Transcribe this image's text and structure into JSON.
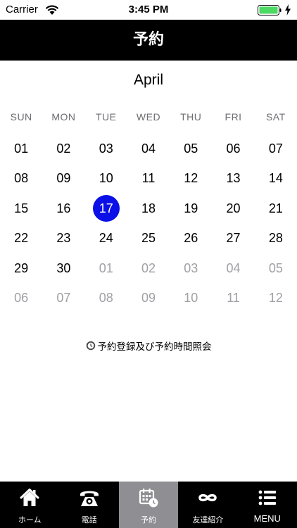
{
  "status_bar": {
    "carrier": "Carrier",
    "time": "3:45 PM",
    "battery_color": "#4cd964"
  },
  "header": {
    "title": "予約"
  },
  "calendar": {
    "month": "April",
    "weekdays": [
      "SUN",
      "MON",
      "TUE",
      "WED",
      "THU",
      "FRI",
      "SAT"
    ],
    "weeks": [
      [
        {
          "d": "01",
          "o": false
        },
        {
          "d": "02",
          "o": false
        },
        {
          "d": "03",
          "o": false
        },
        {
          "d": "04",
          "o": false
        },
        {
          "d": "05",
          "o": false
        },
        {
          "d": "06",
          "o": false
        },
        {
          "d": "07",
          "o": false
        }
      ],
      [
        {
          "d": "08",
          "o": false
        },
        {
          "d": "09",
          "o": false
        },
        {
          "d": "10",
          "o": false
        },
        {
          "d": "11",
          "o": false
        },
        {
          "d": "12",
          "o": false
        },
        {
          "d": "13",
          "o": false
        },
        {
          "d": "14",
          "o": false
        }
      ],
      [
        {
          "d": "15",
          "o": false
        },
        {
          "d": "16",
          "o": false
        },
        {
          "d": "17",
          "o": false
        },
        {
          "d": "18",
          "o": false
        },
        {
          "d": "19",
          "o": false
        },
        {
          "d": "20",
          "o": false
        },
        {
          "d": "21",
          "o": false
        }
      ],
      [
        {
          "d": "22",
          "o": false
        },
        {
          "d": "23",
          "o": false
        },
        {
          "d": "24",
          "o": false
        },
        {
          "d": "25",
          "o": false
        },
        {
          "d": "26",
          "o": false
        },
        {
          "d": "27",
          "o": false
        },
        {
          "d": "28",
          "o": false
        }
      ],
      [
        {
          "d": "29",
          "o": false
        },
        {
          "d": "30",
          "o": false
        },
        {
          "d": "01",
          "o": true
        },
        {
          "d": "02",
          "o": true
        },
        {
          "d": "03",
          "o": true
        },
        {
          "d": "04",
          "o": true
        },
        {
          "d": "05",
          "o": true
        }
      ],
      [
        {
          "d": "06",
          "o": true
        },
        {
          "d": "07",
          "o": true
        },
        {
          "d": "08",
          "o": true
        },
        {
          "d": "09",
          "o": true
        },
        {
          "d": "10",
          "o": true
        },
        {
          "d": "11",
          "o": true
        },
        {
          "d": "12",
          "o": true
        }
      ]
    ],
    "selected_day": "17",
    "selected_color": "#0a10e6"
  },
  "inquiry": {
    "label": "予約登録及び予約時間照会",
    "icon": "clock-history-icon"
  },
  "tabs": [
    {
      "label": "ホーム",
      "icon": "home-icon",
      "active": false
    },
    {
      "label": "電話",
      "icon": "phone-icon",
      "active": false
    },
    {
      "label": "予約",
      "icon": "calendar-clock-icon",
      "active": true
    },
    {
      "label": "友達紹介",
      "icon": "infinity-icon",
      "active": false
    },
    {
      "label": "MENU",
      "icon": "menu-list-icon",
      "active": false
    }
  ]
}
